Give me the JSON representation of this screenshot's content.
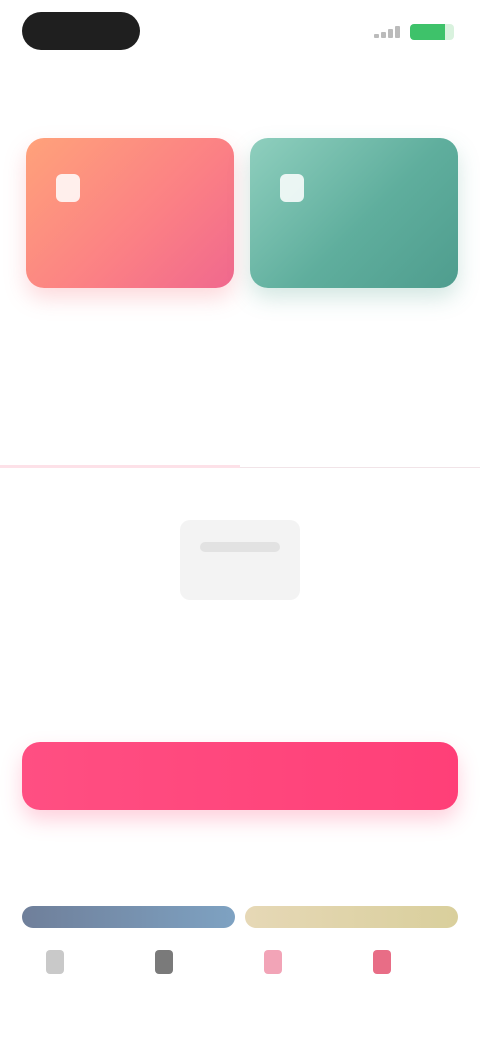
{
  "status_bar": {
    "signal_icon": "signal-icon",
    "battery_icon": "battery-icon",
    "battery_color": "#3ec26a"
  },
  "header": {
    "title": "",
    "link": ""
  },
  "cards": [
    {
      "label": "",
      "icon": "card-icon",
      "color_from": "#ffa27a",
      "color_to": "#f0688e"
    },
    {
      "label": "",
      "icon": "card-icon",
      "color_from": "#8fcfbe",
      "color_to": "#4f9d8e"
    }
  ],
  "stats": [
    {
      "value": "",
      "sub": ""
    },
    {
      "value": "",
      "sub": ""
    }
  ],
  "tabs": {
    "active": "",
    "inactive": "",
    "accent": "#f05a7e"
  },
  "empty_state": {
    "title": "",
    "description": ""
  },
  "primary_button": {
    "label": "",
    "color": "#ff4f82"
  },
  "section": {
    "title": "",
    "link": "",
    "bar_colors": [
      "#7ea2c2",
      "#d9cf9c"
    ]
  }
}
